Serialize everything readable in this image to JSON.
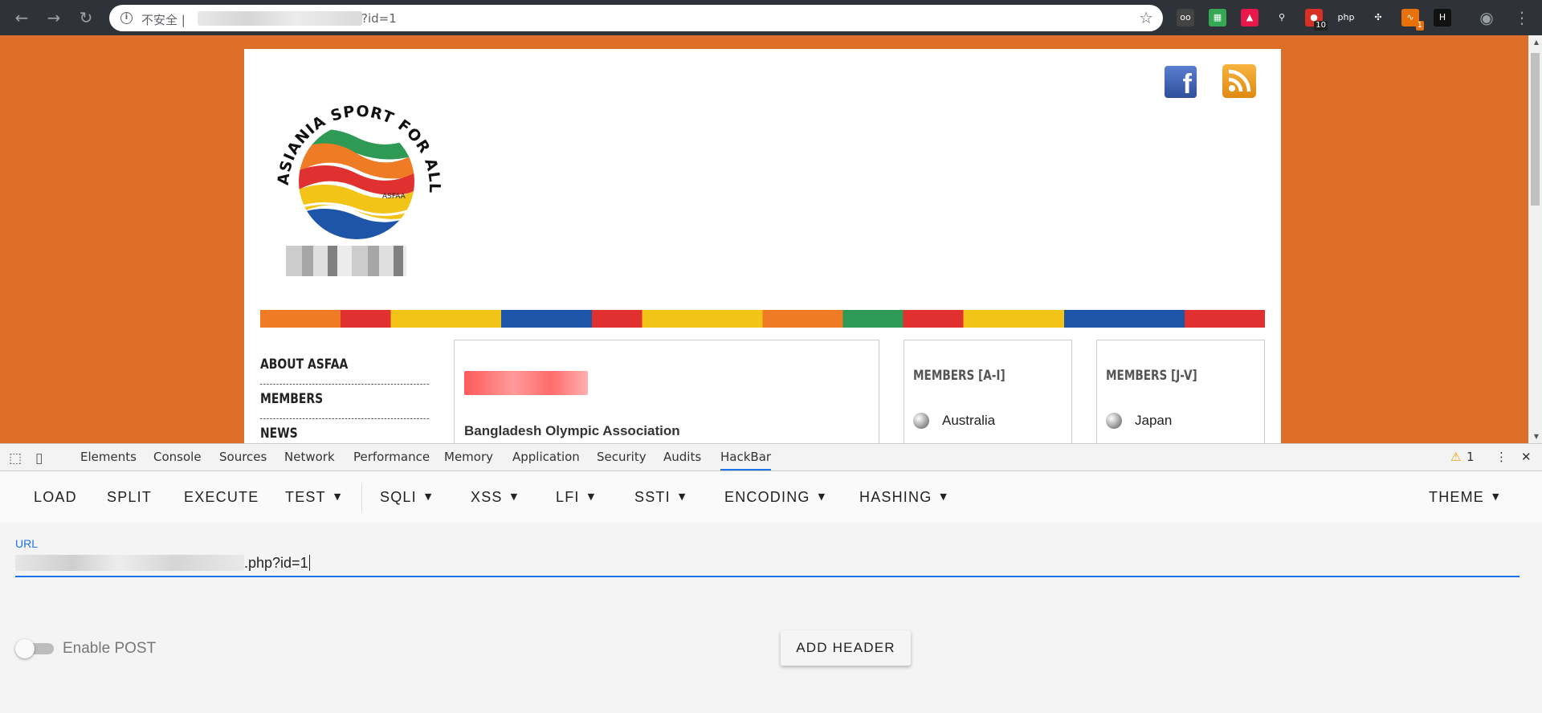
{
  "browser": {
    "insecure_label": "不安全 |",
    "url_tail": "?id=1",
    "extensions": [
      {
        "name": "extension-glasses",
        "color": "#444444",
        "glyph": "oo"
      },
      {
        "name": "extension-sheet",
        "color": "#34a853",
        "glyph": "▦"
      },
      {
        "name": "extension-arrow",
        "color": "#e8184a",
        "glyph": "▲"
      },
      {
        "name": "extension-pin",
        "color": "#2f3238",
        "glyph": "⚲"
      },
      {
        "name": "extension-cookie",
        "color": "#d93025",
        "glyph": "●",
        "badge": "10"
      },
      {
        "name": "extension-php",
        "color": "#2f3238",
        "glyph": "php"
      },
      {
        "name": "extension-puzzle",
        "color": "#2f3238",
        "glyph": "✣"
      },
      {
        "name": "extension-proxy",
        "color": "#e8710a",
        "glyph": "∿",
        "badge": "1"
      },
      {
        "name": "extension-h",
        "color": "#111111",
        "glyph": "H"
      }
    ]
  },
  "site": {
    "nav": [
      "ABOUT ASFAA",
      "MEMBERS",
      "NEWS"
    ],
    "news_subtitle": "Bangladesh Olympic Association",
    "members_a_i": {
      "title": "MEMBERS [A-I]",
      "first": "Australia"
    },
    "members_j_v": {
      "title": "MEMBERS [J-V]",
      "first": "Japan"
    },
    "logo_text_top": "ASIANIA SPORT FOR ALL ASSOCIATION",
    "logo_text_center": "ASFAA"
  },
  "devtools": {
    "tabs": [
      "Elements",
      "Console",
      "Sources",
      "Network",
      "Performance",
      "Memory",
      "Application",
      "Security",
      "Audits",
      "HackBar"
    ],
    "active_tab": "HackBar",
    "warning_count": "1"
  },
  "hackbar": {
    "buttons": [
      "LOAD",
      "SPLIT",
      "EXECUTE"
    ],
    "menus": [
      "TEST",
      "SQLI",
      "XSS",
      "LFI",
      "SSTI",
      "ENCODING",
      "HASHING"
    ],
    "theme": "THEME",
    "url_label": "URL",
    "url_value_tail": ".php?id=1",
    "enable_post_label": "Enable POST",
    "add_header_label": "ADD HEADER"
  },
  "colors": {
    "page_background": "#de6f28",
    "accent": "#1a73e8"
  }
}
